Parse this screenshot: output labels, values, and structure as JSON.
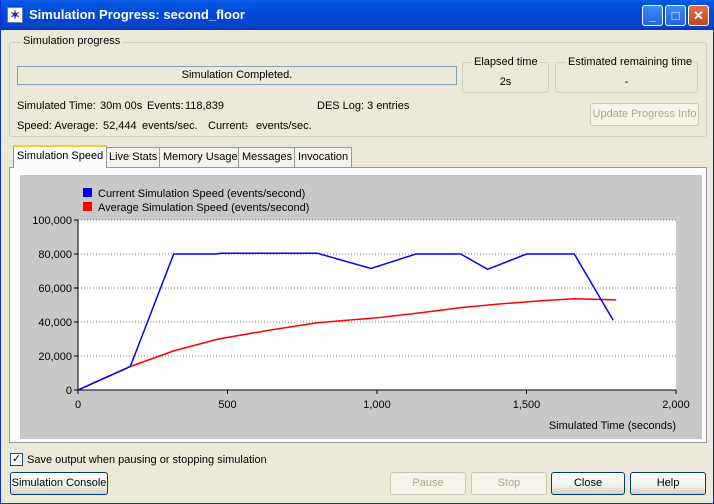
{
  "window": {
    "title": "Simulation Progress: second_floor"
  },
  "progress_group": {
    "label": "Simulation progress",
    "status": "Simulation Completed.",
    "simulated_time_label": "Simulated Time:",
    "simulated_time": "30m 00s",
    "events_label": "Events:",
    "events": "118,839",
    "des_log": "DES Log: 3 entries",
    "speed_label": "Speed: Average:",
    "speed_average": "52,444",
    "speed_unit_1": "events/sec.",
    "current_label": "Current:",
    "speed_current": "-",
    "speed_unit_2": "events/sec.",
    "elapsed_label": "Elapsed time",
    "elapsed_value": "2s",
    "remaining_label": "Estimated remaining time",
    "remaining_value": "-",
    "update_button": "Update Progress Info"
  },
  "tabs": [
    {
      "label": "Simulation Speed",
      "active": true
    },
    {
      "label": "Live Stats"
    },
    {
      "label": "Memory Usage"
    },
    {
      "label": "Messages"
    },
    {
      "label": "Invocation"
    }
  ],
  "chart_data": {
    "type": "line",
    "xlabel": "Simulated Time (seconds)",
    "ylabel": "",
    "xlim": [
      0,
      2000
    ],
    "ylim": [
      0,
      100000
    ],
    "x_ticks": [
      0,
      500,
      1000,
      1500,
      2000
    ],
    "x_tick_labels": [
      "0",
      "500",
      "1,000",
      "1,500",
      "2,000"
    ],
    "y_ticks": [
      0,
      20000,
      40000,
      60000,
      80000,
      100000
    ],
    "y_tick_labels": [
      "0",
      "20,000",
      "40,000",
      "60,000",
      "80,000",
      "100,000"
    ],
    "grid": "horizontal dotted",
    "legend_placement": "top-left",
    "series": [
      {
        "name": "Current Simulation Speed (events/second)",
        "color": "#0000ff",
        "points": [
          [
            0,
            0
          ],
          [
            175,
            13800
          ],
          [
            320,
            80000
          ],
          [
            460,
            80000
          ],
          [
            480,
            80500
          ],
          [
            800,
            80500
          ],
          [
            980,
            71500
          ],
          [
            1130,
            80000
          ],
          [
            1280,
            80000
          ],
          [
            1370,
            71000
          ],
          [
            1500,
            80000
          ],
          [
            1660,
            80000
          ],
          [
            1790,
            41000
          ]
        ]
      },
      {
        "name": "Average Simulation Speed (events/second)",
        "color": "#ff0000",
        "points": [
          [
            0,
            0
          ],
          [
            175,
            13800
          ],
          [
            320,
            23000
          ],
          [
            470,
            30000
          ],
          [
            650,
            35500
          ],
          [
            800,
            39500
          ],
          [
            1000,
            42500
          ],
          [
            1150,
            45500
          ],
          [
            1280,
            48500
          ],
          [
            1400,
            50500
          ],
          [
            1550,
            52500
          ],
          [
            1660,
            53700
          ],
          [
            1800,
            53000
          ]
        ]
      }
    ]
  },
  "footer": {
    "save_checkbox_label": "Save output when pausing or stopping simulation",
    "save_checked": true,
    "console_button": "Simulation Console",
    "pause_button": "Pause",
    "stop_button": "Stop",
    "close_button": "Close",
    "help_button": "Help"
  }
}
